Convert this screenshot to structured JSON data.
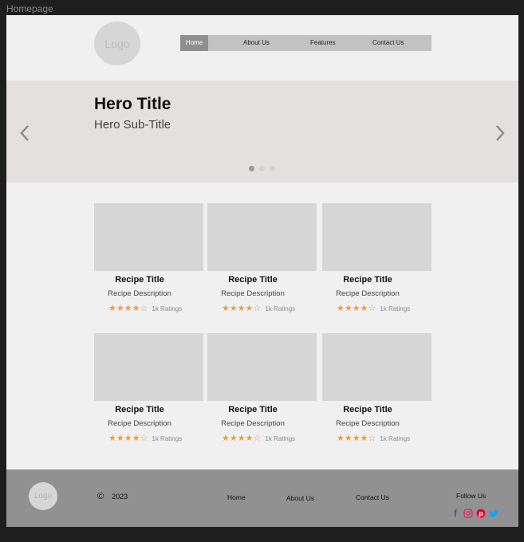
{
  "frame": {
    "label": "Homepage"
  },
  "header": {
    "logo_text": "Logo",
    "nav": [
      "Home",
      "About Us",
      "Features",
      "Contact Us"
    ]
  },
  "hero": {
    "title": "Hero Title",
    "subtitle": "Hero Sub-Title",
    "slide_count": 3,
    "active_slide": 1
  },
  "cards": [
    {
      "title": "Recipe Title",
      "description": "Recipe Description",
      "stars": 4,
      "max_stars": 5,
      "ratings": "1k Ratings"
    },
    {
      "title": "Recipe Title",
      "description": "Recipe Description",
      "stars": 4,
      "max_stars": 5,
      "ratings": "1k Ratings"
    },
    {
      "title": "Recipe Title",
      "description": "Recipe Description",
      "stars": 4,
      "max_stars": 5,
      "ratings": "1k Ratings"
    },
    {
      "title": "Recipe Title",
      "description": "Recipe Description",
      "stars": 4,
      "max_stars": 5,
      "ratings": "1k Ratings"
    },
    {
      "title": "Recipe Title",
      "description": "Recipe Description",
      "stars": 4,
      "max_stars": 5,
      "ratings": "1k Ratings"
    },
    {
      "title": "Recipe Title",
      "description": "Recipe Description",
      "stars": 4,
      "max_stars": 5,
      "ratings": "1k Ratings"
    }
  ],
  "footer": {
    "logo_text": "Logo",
    "copyright_symbol": "©",
    "year": "2023",
    "links": [
      "Home",
      "About Us",
      "Contact Us"
    ],
    "follow_label": "Follow Us",
    "social_icons": [
      "facebook-icon",
      "instagram-icon",
      "pinterest-icon",
      "twitter-icon"
    ]
  },
  "colors": {
    "star": "#f39c34",
    "facebook": "#3b5998",
    "instagram": "#e1306c",
    "pinterest": "#e60023",
    "twitter": "#1da1f2"
  }
}
